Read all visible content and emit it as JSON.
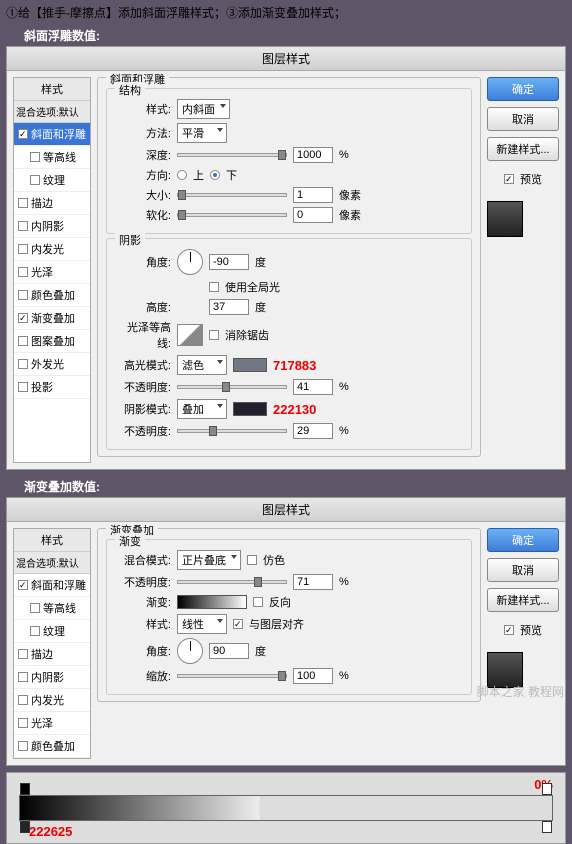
{
  "instruction": "①给【推手-摩擦点】添加斜面浮雕样式；③添加渐变叠加样式；",
  "panel1": {
    "label": "斜面浮雕数值:",
    "title": "图层样式",
    "styles_head": "样式",
    "blend_default": "混合选项:默认",
    "items": [
      "斜面和浮雕",
      "等高线",
      "纹理",
      "描边",
      "内阴影",
      "内发光",
      "光泽",
      "颜色叠加",
      "渐变叠加",
      "图案叠加",
      "外发光",
      "投影"
    ],
    "group_title": "斜面和浮雕",
    "structure": "结构",
    "style_label": "样式:",
    "style_val": "内斜面",
    "method_label": "方法:",
    "method_val": "平滑",
    "depth_label": "深度:",
    "depth_val": "1000",
    "direction_label": "方向:",
    "dir_up": "上",
    "dir_down": "下",
    "size_label": "大小:",
    "size_val": "1",
    "soften_label": "软化:",
    "soften_val": "0",
    "pixel": "像素",
    "percent": "%",
    "shadow": "阴影",
    "angle_label": "角度:",
    "angle_val": "-90",
    "degree": "度",
    "global": "使用全局光",
    "altitude_label": "高度:",
    "altitude_val": "37",
    "gloss_label": "光泽等高线:",
    "antialias": "消除锯齿",
    "hilite_label": "高光模式:",
    "hilite_mode": "滤色",
    "hilite_color": "717883",
    "opacity_label": "不透明度:",
    "hilite_op": "41",
    "shadow_label": "阴影模式:",
    "shadow_mode": "叠加",
    "shadow_color": "222130",
    "shadow_op": "29",
    "buttons": {
      "ok": "确定",
      "cancel": "取消",
      "new": "新建样式...",
      "preview": "预览"
    }
  },
  "panel2": {
    "label": "渐变叠加数值:",
    "title": "图层样式",
    "group_title": "渐变叠加",
    "grad": "渐变",
    "blend_label": "混合模式:",
    "blend_val": "正片叠底",
    "dither": "仿色",
    "opacity_label": "不透明度:",
    "opacity_val": "71",
    "grad_label": "渐变:",
    "reverse": "反向",
    "style_label": "样式:",
    "style_val": "线性",
    "align": "与图层对齐",
    "angle_label": "角度:",
    "angle_val": "90",
    "degree": "度",
    "scale_label": "缩放:",
    "scale_val": "100",
    "percent": "%"
  },
  "grad_editor": {
    "right_annot": "0%",
    "left_annot": "222625"
  },
  "watermark": "脚本之家 教程网"
}
